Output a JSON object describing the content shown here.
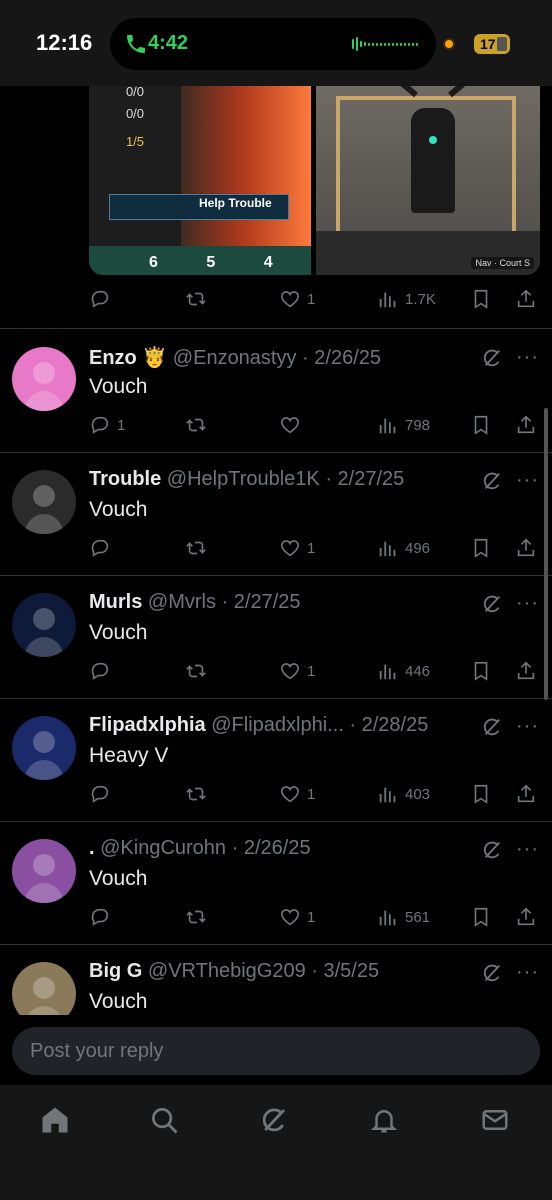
{
  "status_bar": {
    "time": "12:16",
    "call_time": "4:42",
    "battery": "17"
  },
  "top_post": {
    "media_left": {
      "scores": [
        "0/0",
        "0/0",
        "1/5"
      ],
      "banner": "Help Trouble",
      "digits": "6 5 4"
    },
    "media_right": {
      "watermark": "Nav · Court S"
    },
    "stats": {
      "replies": "",
      "reposts": "",
      "likes": "1",
      "views": "1.7K"
    }
  },
  "replies": [
    {
      "name": "Enzo 🤴",
      "handle": "@Enzonastyy",
      "date": "2/26/25",
      "text": "Vouch",
      "stats": {
        "replies": "1",
        "reposts": "",
        "likes": "",
        "views": "798"
      },
      "avatar_color": "#e879c9"
    },
    {
      "name": "Trouble",
      "handle": "@HelpTrouble1K",
      "date": "2/27/25",
      "text": "Vouch",
      "stats": {
        "replies": "",
        "reposts": "",
        "likes": "1",
        "views": "496"
      },
      "avatar_color": "#2b2b2b"
    },
    {
      "name": "Murls",
      "handle": "@Mvrls",
      "date": "2/27/25",
      "text": "Vouch",
      "stats": {
        "replies": "",
        "reposts": "",
        "likes": "1",
        "views": "446"
      },
      "avatar_color": "#0d1a3a"
    },
    {
      "name": "Flipadxlphia",
      "handle": "@Flipadxlphi...",
      "date": "2/28/25",
      "text": "Heavy V",
      "stats": {
        "replies": "",
        "reposts": "",
        "likes": "1",
        "views": "403"
      },
      "avatar_color": "#1b2a6b"
    },
    {
      "name": ".",
      "handle": "@KingCurohn",
      "date": "2/26/25",
      "text": "Vouch",
      "stats": {
        "replies": "",
        "reposts": "",
        "likes": "1",
        "views": "561"
      },
      "avatar_color": "#8a4fa0"
    },
    {
      "name": "Big G",
      "handle": "@VRThebigG209",
      "date": "3/5/25",
      "text": "Vouch",
      "stats": {
        "replies": "",
        "reposts": "",
        "likes": "",
        "views": ""
      },
      "avatar_color": "#8a7a5a"
    }
  ],
  "composer": {
    "placeholder": "Post your reply"
  },
  "tabs": [
    "home-icon",
    "search-icon",
    "grok-icon",
    "notifications-icon",
    "messages-icon"
  ],
  "colors": {
    "background": "#000000",
    "text": "#e7e9ea",
    "muted": "#71767b",
    "divider": "#2f3336",
    "call_green": "#30d158"
  }
}
